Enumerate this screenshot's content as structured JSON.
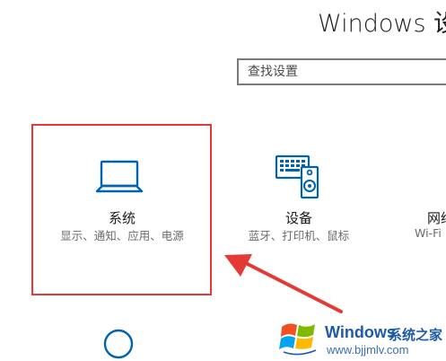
{
  "header": {
    "title": "Windows 设置"
  },
  "search": {
    "placeholder": "查找设置"
  },
  "tiles": [
    {
      "label": "系统",
      "description": "显示、通知、应用、电源"
    },
    {
      "label": "设备",
      "description": "蓝牙、打印机、鼠标"
    },
    {
      "label": "网络",
      "description": "Wi-Fi"
    }
  ],
  "colors": {
    "accent": "#0063b1",
    "highlight": "#e53935",
    "watermark_blue": "#1e5aa8"
  },
  "icons": {
    "system": "laptop-icon",
    "devices": "keyboard-speaker-icon",
    "accounts": "person-icon",
    "watermark": "windows-logo-icon"
  },
  "watermark": {
    "brand": "Windows",
    "brand_cn": "系统之家",
    "url": "www.bjjmlv.com"
  }
}
